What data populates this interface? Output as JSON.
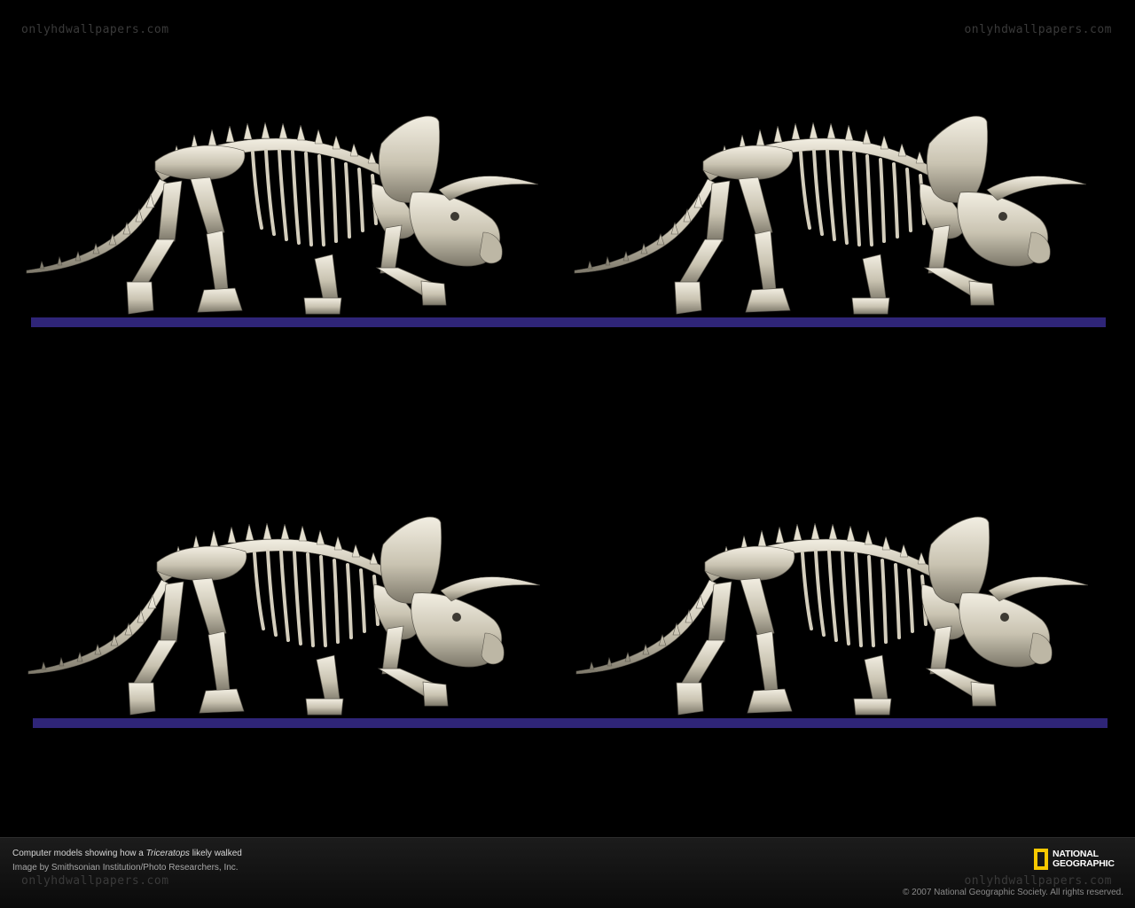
{
  "watermarks": {
    "top_left": "onlyhdwallpapers.com",
    "top_right": "onlyhdwallpapers.com",
    "bottom_left": "onlyhdwallpapers.com",
    "bottom_right": "onlyhdwallpapers.com"
  },
  "scene": {
    "background_color": "#000000",
    "ground_color": "#2f2578",
    "bone_color": "#d9d4c4",
    "frames": [
      {
        "description": "walk-pose-1"
      },
      {
        "description": "walk-pose-2"
      },
      {
        "description": "walk-pose-3"
      },
      {
        "description": "walk-pose-4"
      }
    ]
  },
  "caption": {
    "line1_prefix": "Computer models showing how a ",
    "line1_italic": "Triceratops",
    "line1_suffix": " likely walked",
    "line2": "Image by Smithsonian Institution/Photo Researchers, Inc.",
    "copyright": "© 2007 National Geographic Society. All rights reserved."
  },
  "logo": {
    "line1": "NATIONAL",
    "line2": "GEOGRAPHIC",
    "frame_color": "#f6c800"
  }
}
